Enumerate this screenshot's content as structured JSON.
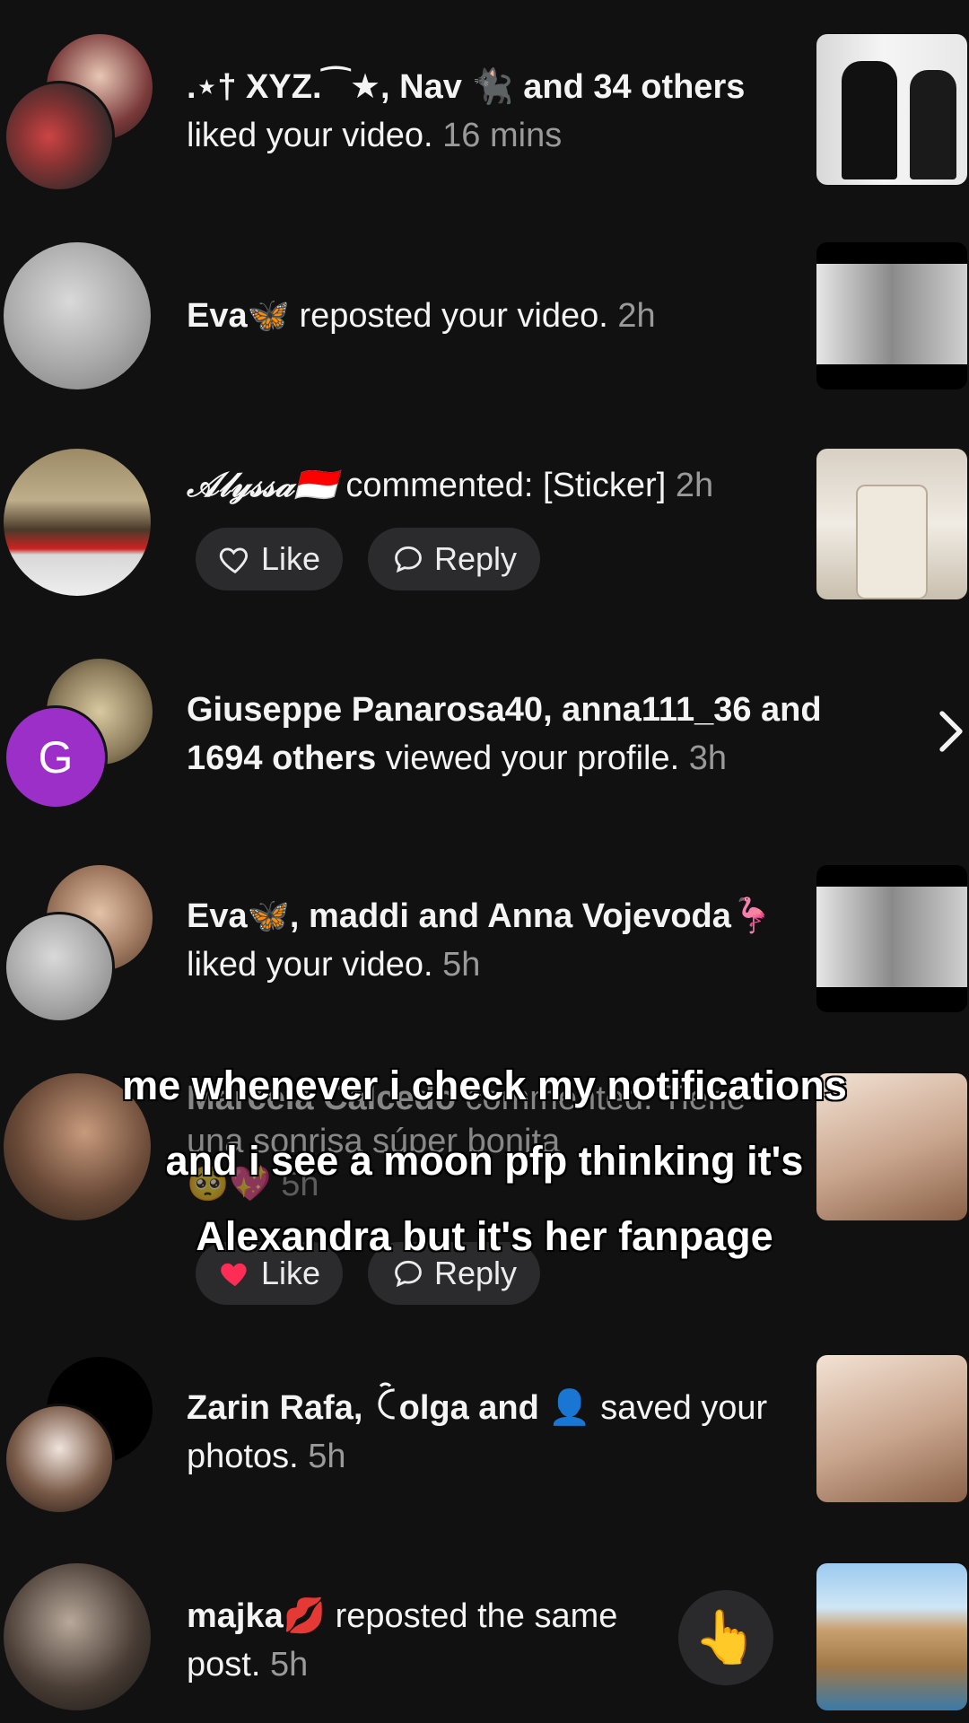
{
  "notifications": [
    {
      "actor": ".⋆† XYZ.⁀★, Nav 🐈‍⬛ and 34 others",
      "action": "liked your video.",
      "time": "16 mins"
    },
    {
      "actor": "Eva🦋",
      "action": "reposted your video.",
      "time": "2h"
    },
    {
      "actor": "𝒜𝓁𝓎𝓈𝓈𝒶🇮🇩",
      "action": "commented: [Sticker]",
      "time": "2h",
      "like_label": "Like",
      "reply_label": "Reply"
    },
    {
      "actor": "Giuseppe Panarosa40, anna111_36 and",
      "actor2": "1694 others",
      "action": "viewed your profile.",
      "time": "3h",
      "avatar_letter": "G"
    },
    {
      "actor": "Eva🦋, maddi and Anna Vojevoda🦩",
      "action": "liked your video.",
      "time": "5h"
    },
    {
      "actor": "Marcela Calcedo",
      "action": "commented: Tiene",
      "line2": "una sonrisa súper bonita",
      "emojis": "🥺💖",
      "time": "5h",
      "like_label": "Like",
      "reply_label": "Reply"
    },
    {
      "actor": "Zarin Rafa, ꉓolga and 👤",
      "action": "saved your",
      "line2": "photos.",
      "time": "5h"
    },
    {
      "actor": "majka💋",
      "action": "reposted the same",
      "line2": "post.",
      "time": "5h"
    }
  ],
  "caption": {
    "line1": "me whenever i check my notifications",
    "line2": "and i see a moon pfp thinking it's",
    "line3": "Alexandra but it's her fanpage"
  },
  "point_emoji": "👆",
  "colors": {
    "background": "#111112",
    "accent_purple": "#9b2fc7",
    "like_red": "#ff2d55"
  }
}
